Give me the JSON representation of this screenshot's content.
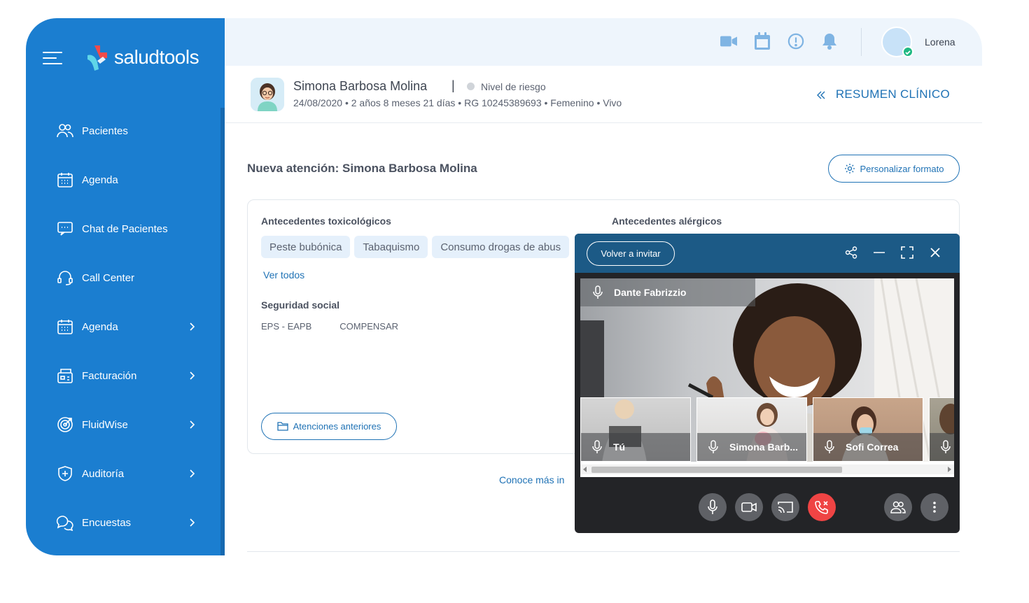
{
  "brand": {
    "name": "saludtools"
  },
  "sidebar": {
    "items": [
      {
        "label": "Pacientes",
        "icon": "users-icon",
        "has_children": false
      },
      {
        "label": "Agenda",
        "icon": "calendar-icon",
        "has_children": false
      },
      {
        "label": "Chat de Pacientes",
        "icon": "chat-icon",
        "has_children": false
      },
      {
        "label": "Call Center",
        "icon": "headset-icon",
        "has_children": false
      },
      {
        "label": "Agenda",
        "icon": "calendar-icon",
        "has_children": true
      },
      {
        "label": "Facturación",
        "icon": "cash-register-icon",
        "has_children": true
      },
      {
        "label": "FluidWise",
        "icon": "target-icon",
        "has_children": true
      },
      {
        "label": "Auditoría",
        "icon": "shield-plus-icon",
        "has_children": true
      },
      {
        "label": "Encuestas",
        "icon": "survey-chat-icon",
        "has_children": true
      }
    ]
  },
  "topbar": {
    "icons": [
      "video-camera-icon",
      "calendar-icon",
      "alert-icon",
      "bell-icon"
    ],
    "user": {
      "name": "Lorena",
      "status": "online"
    }
  },
  "patient": {
    "name": "Simona Barbosa Molina",
    "separator": "|",
    "risk_label": "Nivel de riesgo",
    "info": "24/08/2020 • 2 años 8 meses 21 días • RG 10245389693 • Femenino • Vivo",
    "summary_link": "RESUMEN CLÍNICO"
  },
  "main": {
    "title": "Nueva atención: Simona Barbosa Molina",
    "format_button": "Personalizar formato",
    "sections": {
      "toxicologicos": {
        "title": "Antecedentes toxicológicos",
        "chips": [
          "Peste bubónica",
          "Tabaquismo",
          "Consumo drogas de abus"
        ],
        "see_all": "Ver todos"
      },
      "alergicos": {
        "title": "Antecedentes alérgicos"
      },
      "seguridad_social": {
        "title": "Seguridad social",
        "values": [
          "EPS - EAPB",
          "COMPENSAR"
        ]
      }
    },
    "previous_button": "Atenciones anteriores",
    "learn_more": "Conoce más in"
  },
  "video_call": {
    "invite_button": "Volver a invitar",
    "main_speaker": "Dante Fabrizzio",
    "participants": [
      {
        "name": "Tú"
      },
      {
        "name": "Simona Barb..."
      },
      {
        "name": "Sofi Correa"
      },
      {
        "name": ""
      }
    ],
    "controls": [
      "microphone-icon",
      "camera-icon",
      "screen-share-icon",
      "end-call-icon",
      "participants-icon",
      "more-vertical-icon"
    ],
    "colors": {
      "end_call": "#ef4444",
      "header": "#1c5a86"
    }
  },
  "colors": {
    "sidebar": "#1b7ed0",
    "accent": "#1f72b5",
    "online": "#1fb983"
  }
}
